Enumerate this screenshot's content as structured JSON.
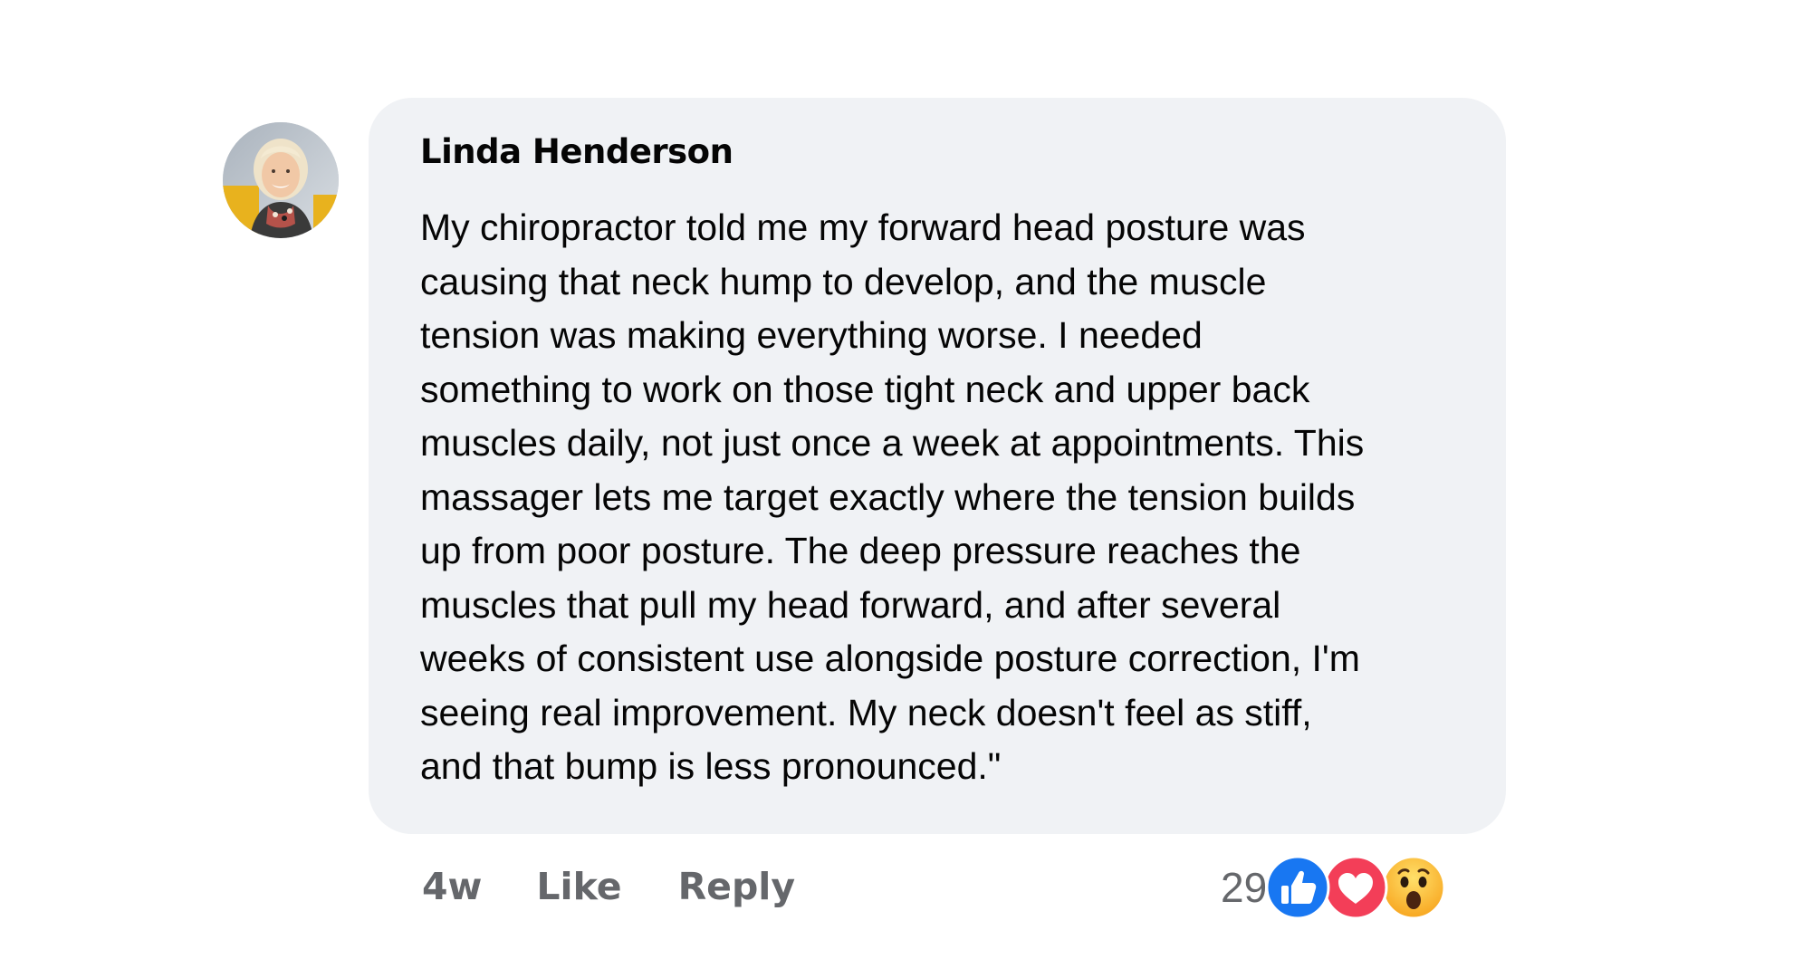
{
  "comment": {
    "author": "Linda Henderson",
    "text": "My chiropractor told me my forward head posture was\ncausing that neck hump to develop, and the muscle\ntension was making everything worse. I needed\nsomething to work on those tight neck and upper back\nmuscles daily, not just once a week at appointments. This\nmassager lets me target exactly where the tension builds\nup from poor posture. The deep pressure reaches the\nmuscles that pull my head forward, and after several\nweeks of consistent use alongside posture correction, I'm\nseeing real improvement. My neck doesn't feel as stiff,\nand that bump is less pronounced.\"",
    "timestamp": "4w",
    "like_label": "Like",
    "reply_label": "Reply",
    "reaction_count": "29",
    "reactions": [
      "like-icon",
      "love-icon",
      "wow-icon"
    ]
  },
  "colors": {
    "bubble_bg": "#f0f2f5",
    "like_blue": "#1877f2",
    "love_red": "#f33e58",
    "wow_yellow": "#f7b125",
    "secondary_text": "#65676b"
  }
}
